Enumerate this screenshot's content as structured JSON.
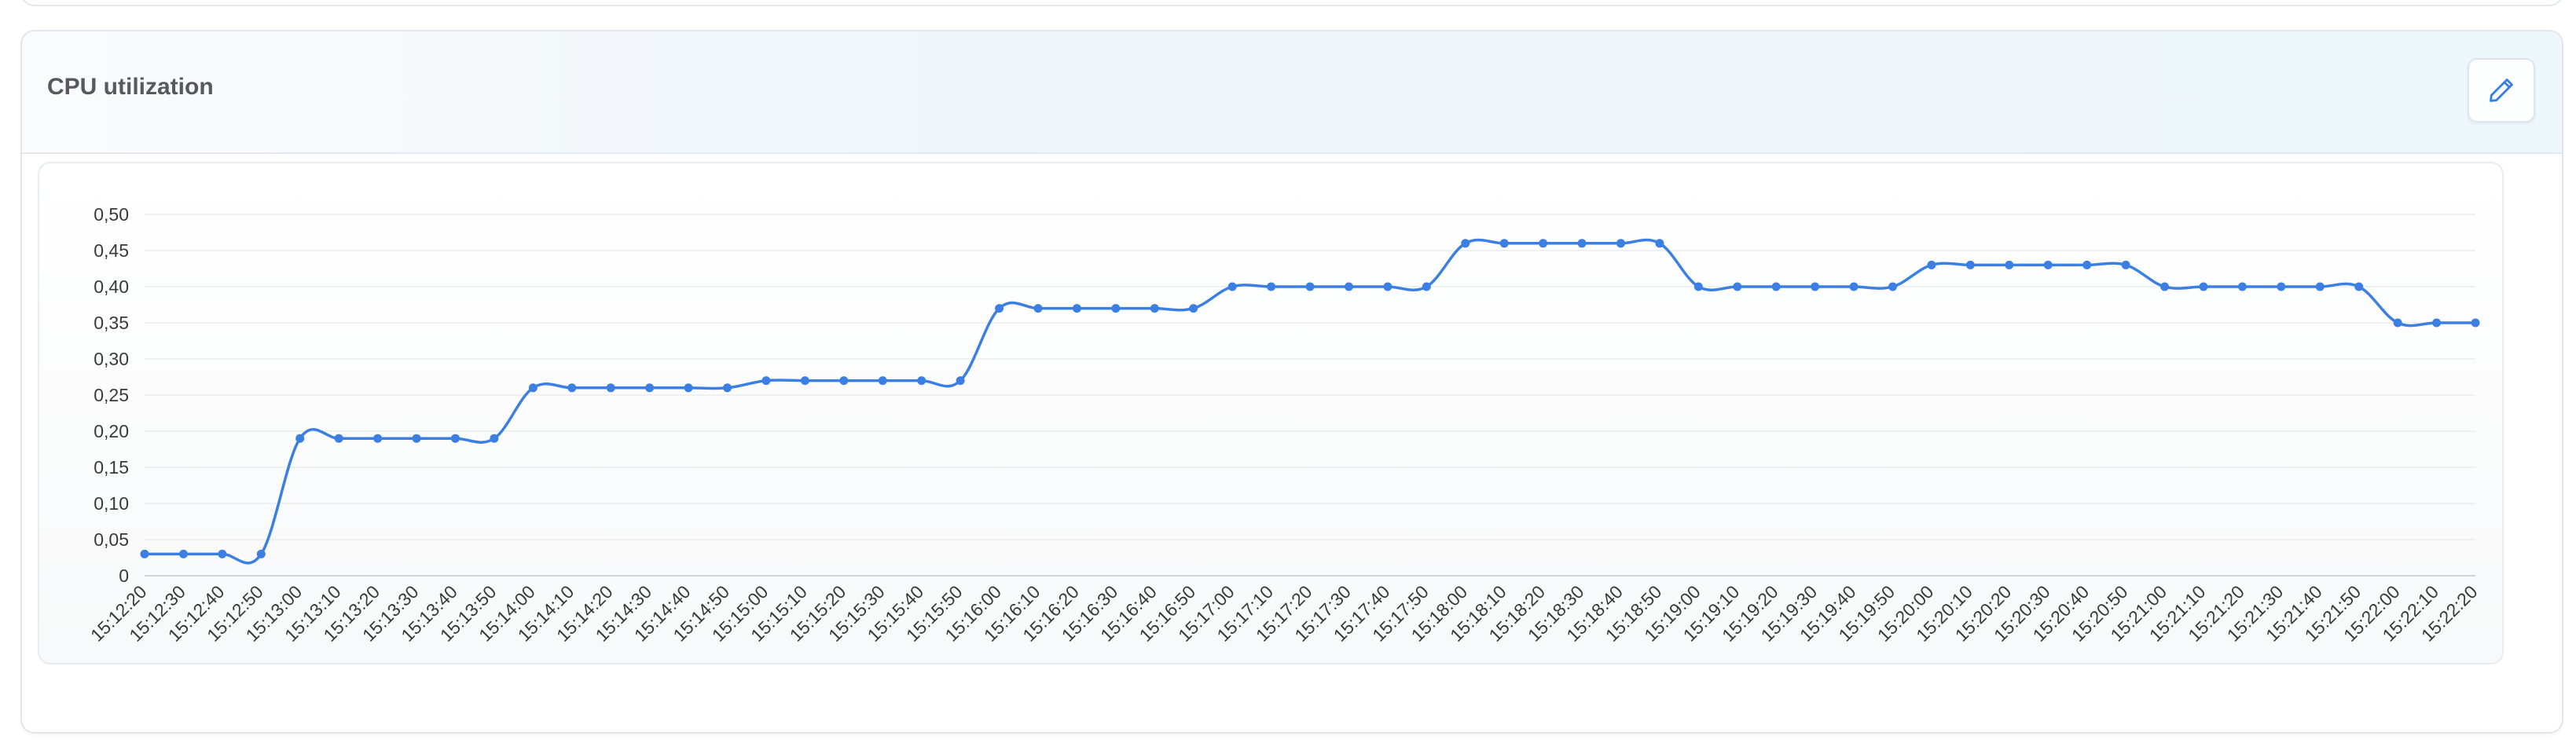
{
  "card": {
    "title": "CPU utilization",
    "edit_icon": "pencil-icon"
  },
  "colors": {
    "line": "#3b7fe3",
    "grid": "#e9ecef",
    "axis_text": "#3a3a3a",
    "title": "#555a61"
  },
  "chart_data": {
    "type": "line",
    "title": "",
    "xlabel": "",
    "ylabel": "",
    "ylim": [
      0,
      0.5
    ],
    "yticks": [
      "0",
      "0,05",
      "0,10",
      "0,15",
      "0,20",
      "0,25",
      "0,30",
      "0,35",
      "0,40",
      "0,45",
      "0,50"
    ],
    "grid": true,
    "legend": "none",
    "x": [
      "15:12:20",
      "15:12:30",
      "15:12:40",
      "15:12:50",
      "15:13:00",
      "15:13:10",
      "15:13:20",
      "15:13:30",
      "15:13:40",
      "15:13:50",
      "15:14:00",
      "15:14:10",
      "15:14:20",
      "15:14:30",
      "15:14:40",
      "15:14:50",
      "15:15:00",
      "15:15:10",
      "15:15:20",
      "15:15:30",
      "15:15:40",
      "15:15:50",
      "15:16:00",
      "15:16:10",
      "15:16:20",
      "15:16:30",
      "15:16:40",
      "15:16:50",
      "15:17:00",
      "15:17:10",
      "15:17:20",
      "15:17:30",
      "15:17:40",
      "15:17:50",
      "15:18:00",
      "15:18:10",
      "15:18:20",
      "15:18:30",
      "15:18:40",
      "15:18:50",
      "15:19:00",
      "15:19:10",
      "15:19:20",
      "15:19:30",
      "15:19:40",
      "15:19:50",
      "15:20:00",
      "15:20:10",
      "15:20:20",
      "15:20:30",
      "15:20:40",
      "15:20:50",
      "15:21:00",
      "15:21:10",
      "15:21:20",
      "15:21:30",
      "15:21:40",
      "15:21:50",
      "15:22:00",
      "15:22:10",
      "15:22:20"
    ],
    "series": [
      {
        "values": [
          0.03,
          0.03,
          0.03,
          0.03,
          0.19,
          0.19,
          0.19,
          0.19,
          0.19,
          0.19,
          0.26,
          0.26,
          0.26,
          0.26,
          0.26,
          0.26,
          0.27,
          0.27,
          0.27,
          0.27,
          0.27,
          0.27,
          0.37,
          0.37,
          0.37,
          0.37,
          0.37,
          0.37,
          0.4,
          0.4,
          0.4,
          0.4,
          0.4,
          0.4,
          0.46,
          0.46,
          0.46,
          0.46,
          0.46,
          0.46,
          0.4,
          0.4,
          0.4,
          0.4,
          0.4,
          0.4,
          0.43,
          0.43,
          0.43,
          0.43,
          0.43,
          0.43,
          0.4,
          0.4,
          0.4,
          0.4,
          0.4,
          0.4,
          0.35,
          0.35,
          0.35
        ]
      }
    ]
  }
}
